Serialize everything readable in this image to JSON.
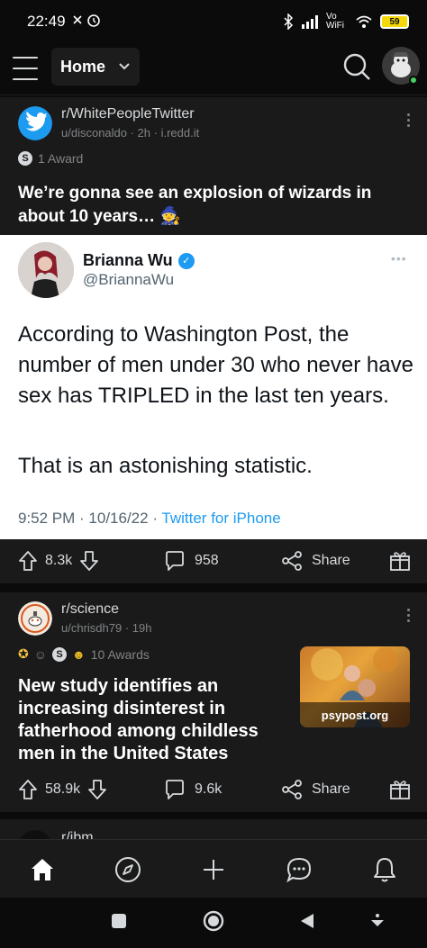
{
  "status_bar": {
    "time": "22:49",
    "network_label": "Vo WiFi",
    "battery": "59"
  },
  "header": {
    "feed_label": "Home",
    "icons": [
      "menu-icon",
      "chevron-down-icon",
      "search-icon",
      "avatar"
    ]
  },
  "posts": [
    {
      "subreddit": "r/WhitePeopleTwitter",
      "meta": "u/disconaldo · 2h · i.redd.it",
      "awards": "1 Award",
      "title": "We’re gonna see an explosion of wizards in about 10 years… 🧙",
      "tweet": {
        "name": "Brianna Wu",
        "handle": "@BriannaWu",
        "text_1": "According to Washington Post, the number of men under 30 who never have sex has TRIPLED in the last ten years.",
        "text_2": "That is an astonishing statistic.",
        "timestamp": "9:52 PM · 10/16/22 · ",
        "source": "Twitter for iPhone"
      },
      "votes": "8.3k",
      "comments": "958",
      "share_label": "Share"
    },
    {
      "subreddit": "r/science",
      "meta": "u/chrisdh79 · 19h",
      "awards": "10 Awards",
      "title": "New study identifies an increasing disinterest in fatherhood among childless men in the United States",
      "thumbnail_label": "psypost.org",
      "votes": "58.9k",
      "comments": "9.6k",
      "share_label": "Share"
    },
    {
      "subreddit": "r/ibm"
    }
  ],
  "bottom_nav": [
    "home-icon",
    "discover-icon",
    "create-icon",
    "chat-icon",
    "notifications-icon"
  ],
  "colors": {
    "background": "#0b0b0b",
    "post_bg": "#1a1a1b",
    "twitter_blue": "#1d9bf0",
    "text_primary": "#ffffff",
    "text_muted": "#818384"
  }
}
